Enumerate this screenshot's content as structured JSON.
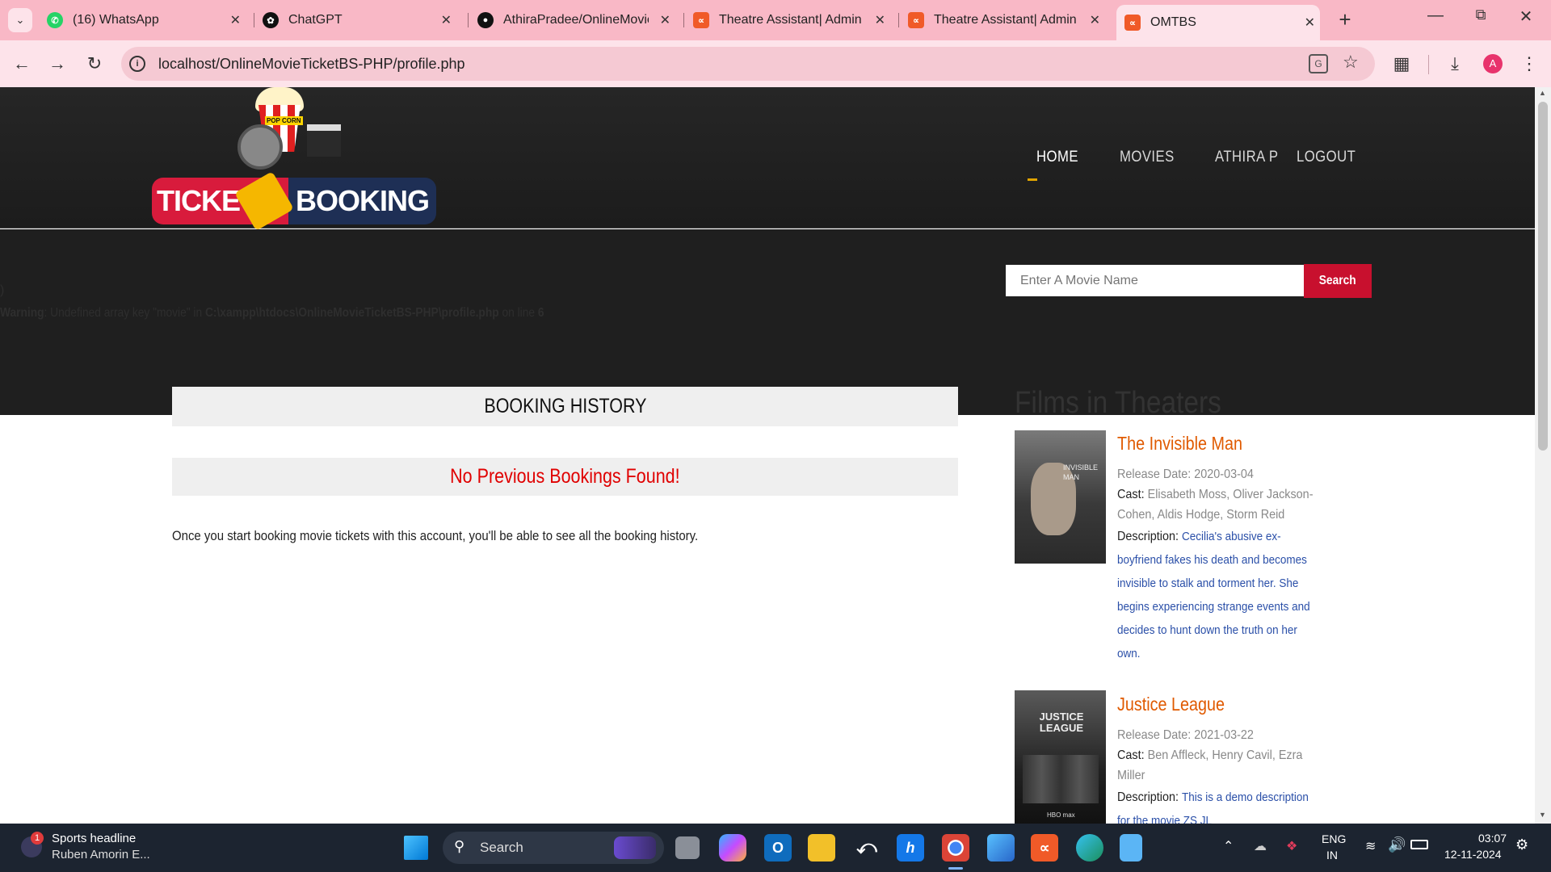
{
  "browser": {
    "tabs": [
      {
        "title": "(16) WhatsApp",
        "icon": "whatsapp-icon",
        "color": "#25d366"
      },
      {
        "title": "ChatGPT",
        "icon": "chatgpt-icon",
        "color": "#111111"
      },
      {
        "title": "AthiraPradee/OnlineMovie",
        "icon": "github-icon",
        "color": "#111111"
      },
      {
        "title": "Theatre Assistant| Admin",
        "icon": "xampp-icon",
        "color": "#f05a28"
      },
      {
        "title": "Theatre Assistant| Admin",
        "icon": "xampp-icon",
        "color": "#f05a28"
      },
      {
        "title": "OMTBS",
        "icon": "xampp-icon",
        "color": "#f05a28"
      }
    ],
    "url": "localhost/OnlineMovieTicketBS-PHP/profile.php",
    "profile_initial": "A"
  },
  "site": {
    "logo": {
      "left": "TICKE",
      "right": "BOOKING",
      "popcorn": "POP CORN"
    },
    "nav": [
      "HOME",
      "MOVIES",
      "ATHIRA P",
      "LOGOUT"
    ],
    "search_placeholder": "Enter A Movie Name",
    "search_button": "Search",
    "warning": {
      "bracket": ")",
      "label": "Warning",
      "text1": ": Undefined array key \"movie\" in ",
      "path": "C:\\xampp\\htdocs\\OnlineMovieTicketBS-PHP\\profile.php",
      "text2": " on line ",
      "line": "6"
    }
  },
  "main": {
    "history_title": "BOOKING HISTORY",
    "no_bookings": "No Previous Bookings Found!",
    "info_text": "Once you start booking movie tickets with this account, you'll be able to see all the booking history."
  },
  "sidebar": {
    "title": "Films in Theaters",
    "films": [
      {
        "title": "The Invisible Man",
        "release_label": "Release Date: ",
        "release": "2020-03-04",
        "cast_label": "Cast: ",
        "cast_line1": "Elisabeth Moss, Oliver Jackson-",
        "cast_line2": "Cohen, Aldis Hodge, Storm Reid",
        "desc_label": "Description: ",
        "desc_line1": "Cecilia's abusive ex-",
        "desc_lines": [
          "boyfriend fakes his death and becomes",
          "invisible to stalk and torment her. She",
          "begins experiencing strange events and",
          "decides to hunt down the truth on her",
          "own."
        ],
        "poster_text": "INVISIBLE MAN"
      },
      {
        "title": "Justice League",
        "release_label": "Release Date: ",
        "release": "2021-03-22",
        "cast_label": "Cast: ",
        "cast_line1": "Ben Affleck, Henry Cavil, Ezra",
        "cast_line2": "Miller",
        "desc_label": "Description: ",
        "desc_line1": "This is a demo description",
        "desc_lines": [
          "for the movie ZS JL"
        ],
        "poster_text": "JUSTICE LEAGUE",
        "poster_sub": "HBO max"
      }
    ]
  },
  "taskbar": {
    "news_title": "Sports headline",
    "news_sub": "Ruben Amorin E...",
    "news_badge": "1",
    "search_label": "Search",
    "lang1": "ENG",
    "lang2": "IN",
    "time": "03:07",
    "date": "12-11-2024"
  },
  "colors": {
    "accent": "#e0a400",
    "film_title": "#e05a00",
    "desc": "#2a4fa8",
    "error": "#e00000",
    "search_btn": "#c8102e"
  }
}
